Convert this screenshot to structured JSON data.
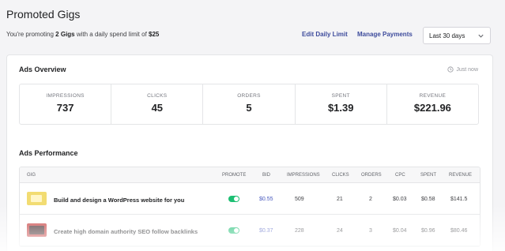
{
  "header": {
    "title": "Promoted Gigs",
    "promo_prefix": "You're promoting",
    "gig_count": "2 Gigs",
    "promo_middle": "with a daily spend limit of",
    "daily_limit": "$25",
    "edit_limit": "Edit Daily Limit",
    "manage_payments": "Manage Payments",
    "date_range": "Last 30 days"
  },
  "overview": {
    "title": "Ads Overview",
    "updated": "Just now",
    "stats": [
      {
        "label": "IMPRESSIONS",
        "value": "737"
      },
      {
        "label": "CLICKS",
        "value": "45"
      },
      {
        "label": "ORDERS",
        "value": "5"
      },
      {
        "label": "SPENT",
        "value": "$1.39"
      },
      {
        "label": "REVENUE",
        "value": "$221.96"
      }
    ]
  },
  "performance": {
    "title": "Ads Performance",
    "columns": [
      "GIG",
      "PROMOTE",
      "BID",
      "IMPRESSIONS",
      "CLICKS",
      "ORDERS",
      "CPC",
      "SPENT",
      "REVENUE"
    ],
    "rows": [
      {
        "gig": "Build and design a WordPress website for you",
        "promote": true,
        "bid": "$0.55",
        "impressions": "509",
        "clicks": "21",
        "orders": "2",
        "cpc": "$0.03",
        "spent": "$0.58",
        "revenue": "$141.5"
      },
      {
        "gig": "Create high domain authority SEO follow backlinks",
        "promote": true,
        "bid": "$0.37",
        "impressions": "228",
        "clicks": "24",
        "orders": "3",
        "cpc": "$0.04",
        "spent": "$0.96",
        "revenue": "$80.46"
      }
    ]
  },
  "colors": {
    "accent_green": "#1dbf73",
    "link_blue": "#3d4b9c"
  },
  "icons": [
    "chevron-down-icon",
    "clock-icon"
  ]
}
